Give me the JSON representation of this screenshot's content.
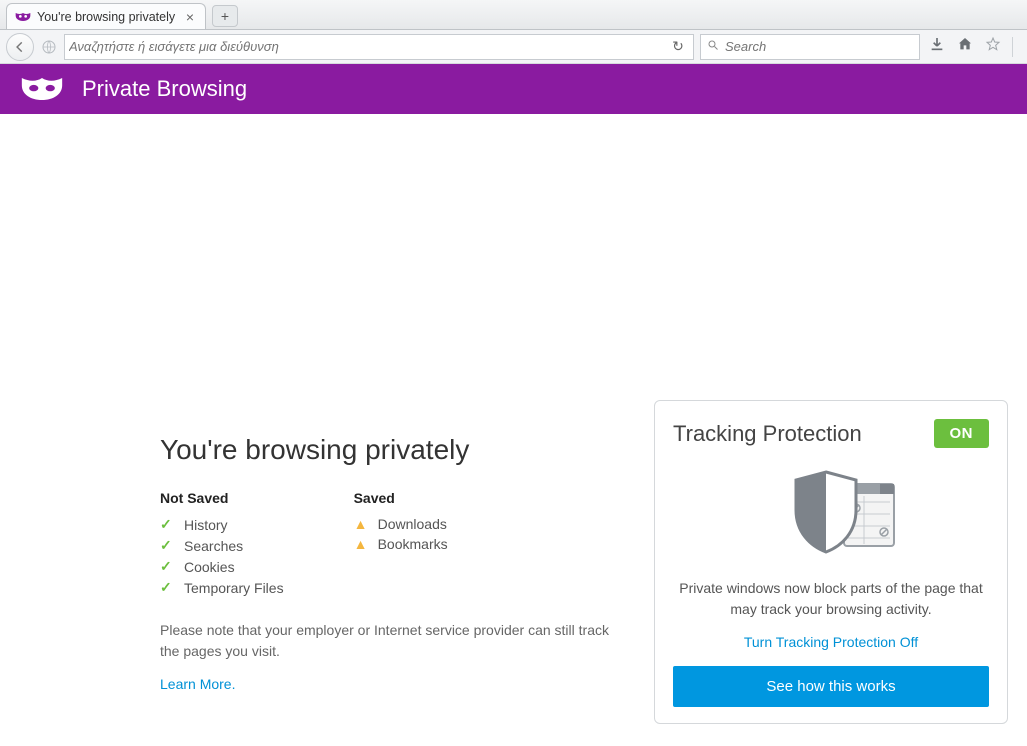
{
  "tab": {
    "title": "You're browsing privately"
  },
  "toolbar": {
    "url_placeholder": "Αναζητήστε ή εισάγετε μια διεύθυνση",
    "search_placeholder": "Search"
  },
  "banner": {
    "title": "Private Browsing"
  },
  "main": {
    "heading": "You're browsing privately",
    "not_saved_label": "Not Saved",
    "saved_label": "Saved",
    "not_saved_items": [
      "History",
      "Searches",
      "Cookies",
      "Temporary Files"
    ],
    "saved_items": [
      "Downloads",
      "Bookmarks"
    ],
    "note": "Please note that your employer or Internet service provider can still track the pages you visit.",
    "learn_more": "Learn More."
  },
  "card": {
    "title": "Tracking Protection",
    "badge": "ON",
    "description": "Private windows now block parts of the page that may track your browsing activity.",
    "turn_off": "Turn Tracking Protection Off",
    "button": "See how this works"
  }
}
